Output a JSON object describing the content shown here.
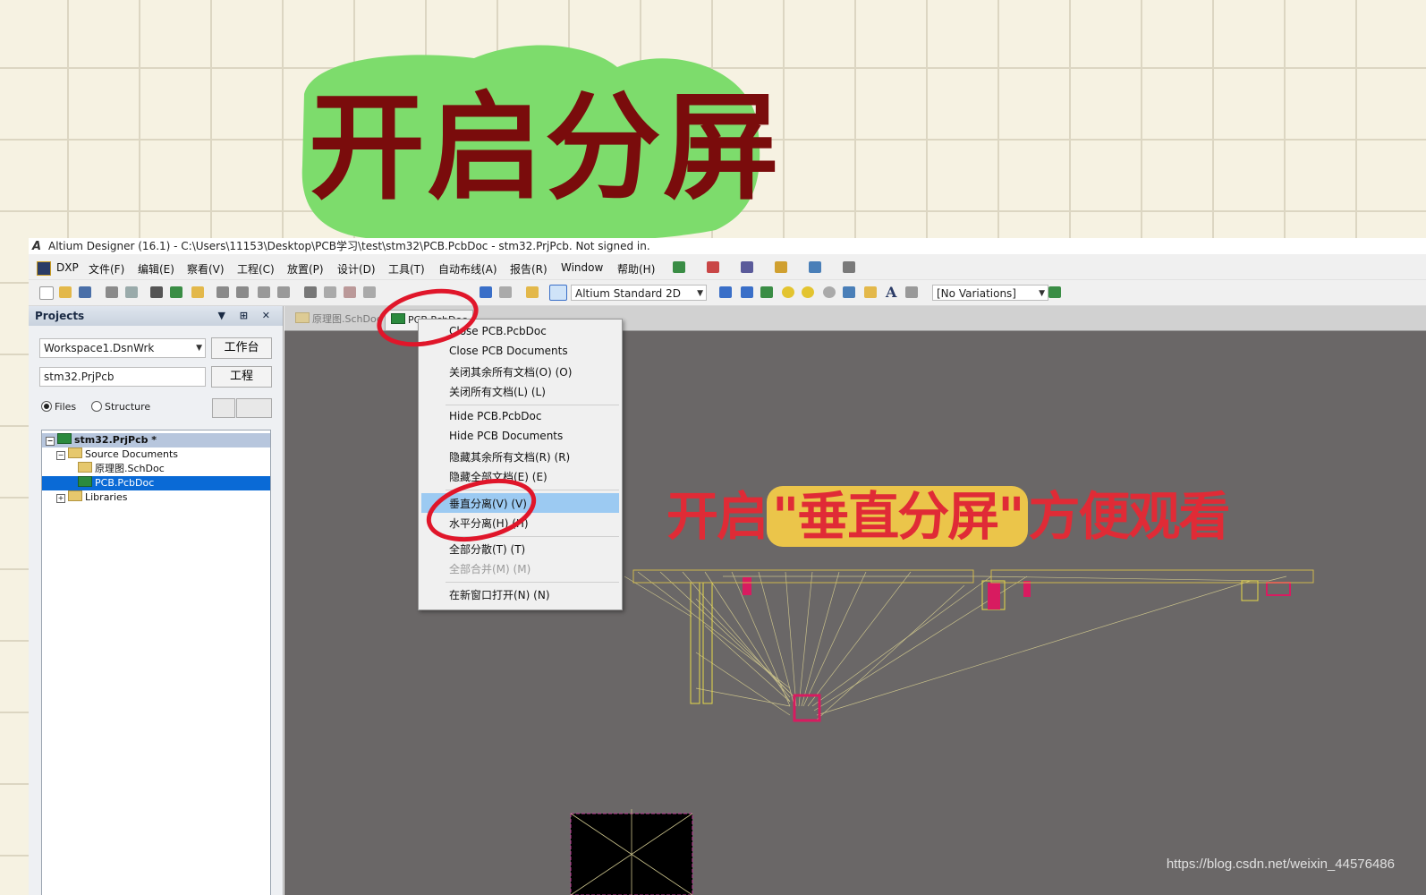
{
  "overlay": {
    "headline": "开启分屏",
    "note": "开启\"垂直分屏\"方便观看",
    "note_prefix": "开启",
    "note_highlight": "\"垂直分屏\"",
    "note_suffix": "方便观看",
    "watermark": "https://blog.csdn.net/weixin_44576486"
  },
  "window": {
    "title": "Altium Designer (16.1) - C:\\Users\\11153\\Desktop\\PCB学习\\test\\stm32\\PCB.PcbDoc - stm32.PrjPcb. Not signed in."
  },
  "menu": [
    "DXP",
    "文件(F)",
    "编辑(E)",
    "察看(V)",
    "工程(C)",
    "放置(P)",
    "设计(D)",
    "工具(T)",
    "自动布线(A)",
    "报告(R)",
    "Window",
    "帮助(H)"
  ],
  "toolbar": {
    "view_mode": "Altium Standard 2D",
    "variations": "[No Variations]"
  },
  "panel": {
    "title": "Projects",
    "workspace": "Workspace1.DsnWrk",
    "workspace_button": "工作台",
    "project": "stm32.PrjPcb",
    "project_button": "工程",
    "radio_files": "Files",
    "radio_structure": "Structure",
    "tree": {
      "project": "stm32.PrjPcb *",
      "source_docs": "Source Documents",
      "sch": "原理图.SchDoc",
      "pcb": "PCB.PcbDoc",
      "libraries": "Libraries"
    }
  },
  "tabs": [
    "原理图.SchDoc",
    "PCB.PcbDoc"
  ],
  "context_menu": {
    "close_doc": "Close PCB.PcbDoc",
    "close_docs": "Close PCB Documents",
    "close_others": "关闭其余所有文档(O) (O)",
    "close_all": "关闭所有文档(L) (L)",
    "hide_doc": "Hide PCB.PcbDoc",
    "hide_docs": "Hide PCB Documents",
    "hide_others": "隐藏其余所有文档(R) (R)",
    "hide_all": "隐藏全部文档(E) (E)",
    "split_vertical": "垂直分离(V) (V)",
    "split_horizontal": "水平分离(H) (H)",
    "tile_all": "全部分散(T) (T)",
    "merge_all": "全部合并(M) (M)",
    "open_new_window": "在新窗口打开(N) (N)"
  },
  "colors": {
    "canvas": "#6a6767",
    "highlight": "#9ccaf2",
    "annotation_red": "#e02b36",
    "headline": "#7a0c0c",
    "headline_bg": "#7ddc6c"
  }
}
